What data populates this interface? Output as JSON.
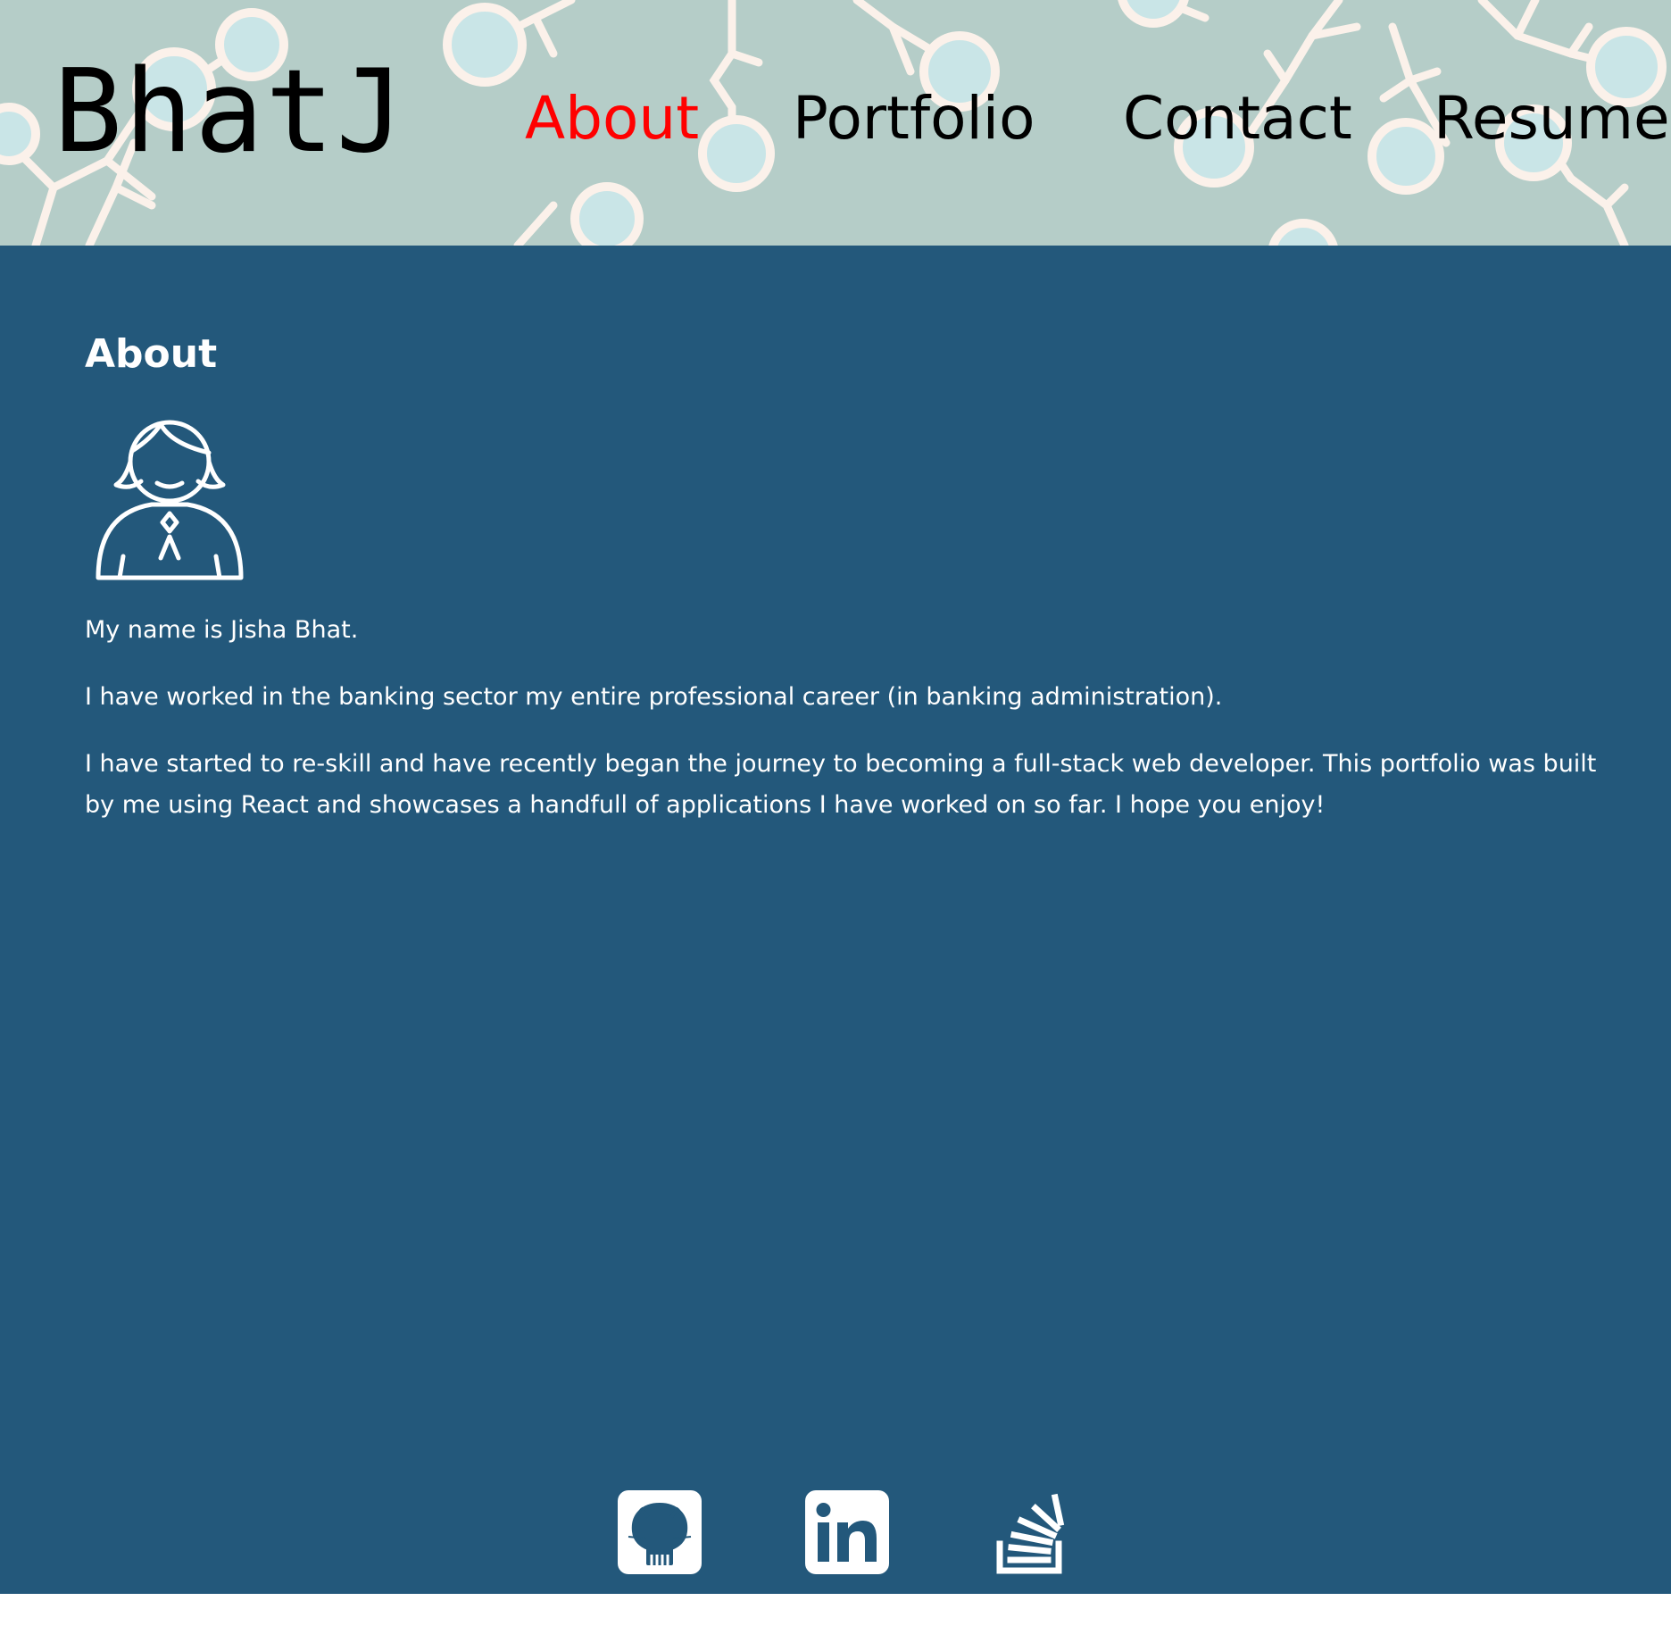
{
  "header": {
    "logo": "BhatJ",
    "nav": [
      {
        "label": "About",
        "active": true
      },
      {
        "label": "Portfolio",
        "active": false
      },
      {
        "label": "Contact",
        "active": false
      },
      {
        "label": "Resume",
        "active": false
      }
    ]
  },
  "about": {
    "title": "About",
    "paragraphs": [
      "My name is Jisha Bhat.",
      "I have worked in the banking sector my entire professional career (in banking administration).",
      "I have started to re-skill and have recently began the journey to becoming a full-stack web developer. This portfolio was built by me using React and showcases a handfull of applications I have worked on so far. I hope you enjoy!"
    ]
  },
  "footer": {
    "icons": [
      "github-icon",
      "linkedin-icon",
      "stackoverflow-icon"
    ]
  },
  "colors": {
    "header_bg": "#b5cdc8",
    "main_bg": "#23587b",
    "active_nav": "#ff0000",
    "text": "#ffffff"
  }
}
